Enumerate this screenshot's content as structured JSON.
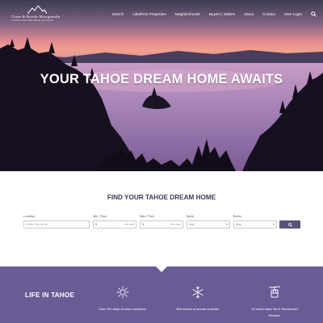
{
  "brand": {
    "name": "Chase & Brooks Mowguardin",
    "tagline": "TAHOE LAKE AND ANGEL ESTATES"
  },
  "nav": {
    "items": [
      "Search",
      "Lakefront Properties",
      "Neighborhoods",
      "Buyers | Sellers",
      "About",
      "Contact",
      "User Login"
    ],
    "search_icon": "search-icon"
  },
  "hero": {
    "title": "YOUR TAHOE DREAM HOME AWAITS"
  },
  "search": {
    "heading": "FIND YOUR TAHOE DREAM HOME",
    "location": {
      "label": "Location",
      "placeholder": "Enter City or Zip"
    },
    "min_price": {
      "label": "Min. Price",
      "prefix": "$",
      "suffix": "No min"
    },
    "max_price": {
      "label": "Max. Price",
      "prefix": "$",
      "suffix": "No max"
    },
    "beds": {
      "label": "Beds",
      "value": "Any"
    },
    "baths": {
      "label": "Baths",
      "value": "Any"
    },
    "button_icon": "search-icon"
  },
  "life": {
    "title": "LIFE IN TAHOE",
    "features": [
      {
        "icon": "sun-icon",
        "text": "Over 300 days of warm sunshine."
      },
      {
        "icon": "snowflake-icon",
        "text": "306 inches of annual snowfall."
      },
      {
        "icon": "ski-lift-icon",
        "text": "15 world class Ski & Snowboard Resorts."
      }
    ]
  },
  "colors": {
    "accent": "#5a5278",
    "band": "#6b5b95",
    "heading": "#3f3a5a"
  }
}
